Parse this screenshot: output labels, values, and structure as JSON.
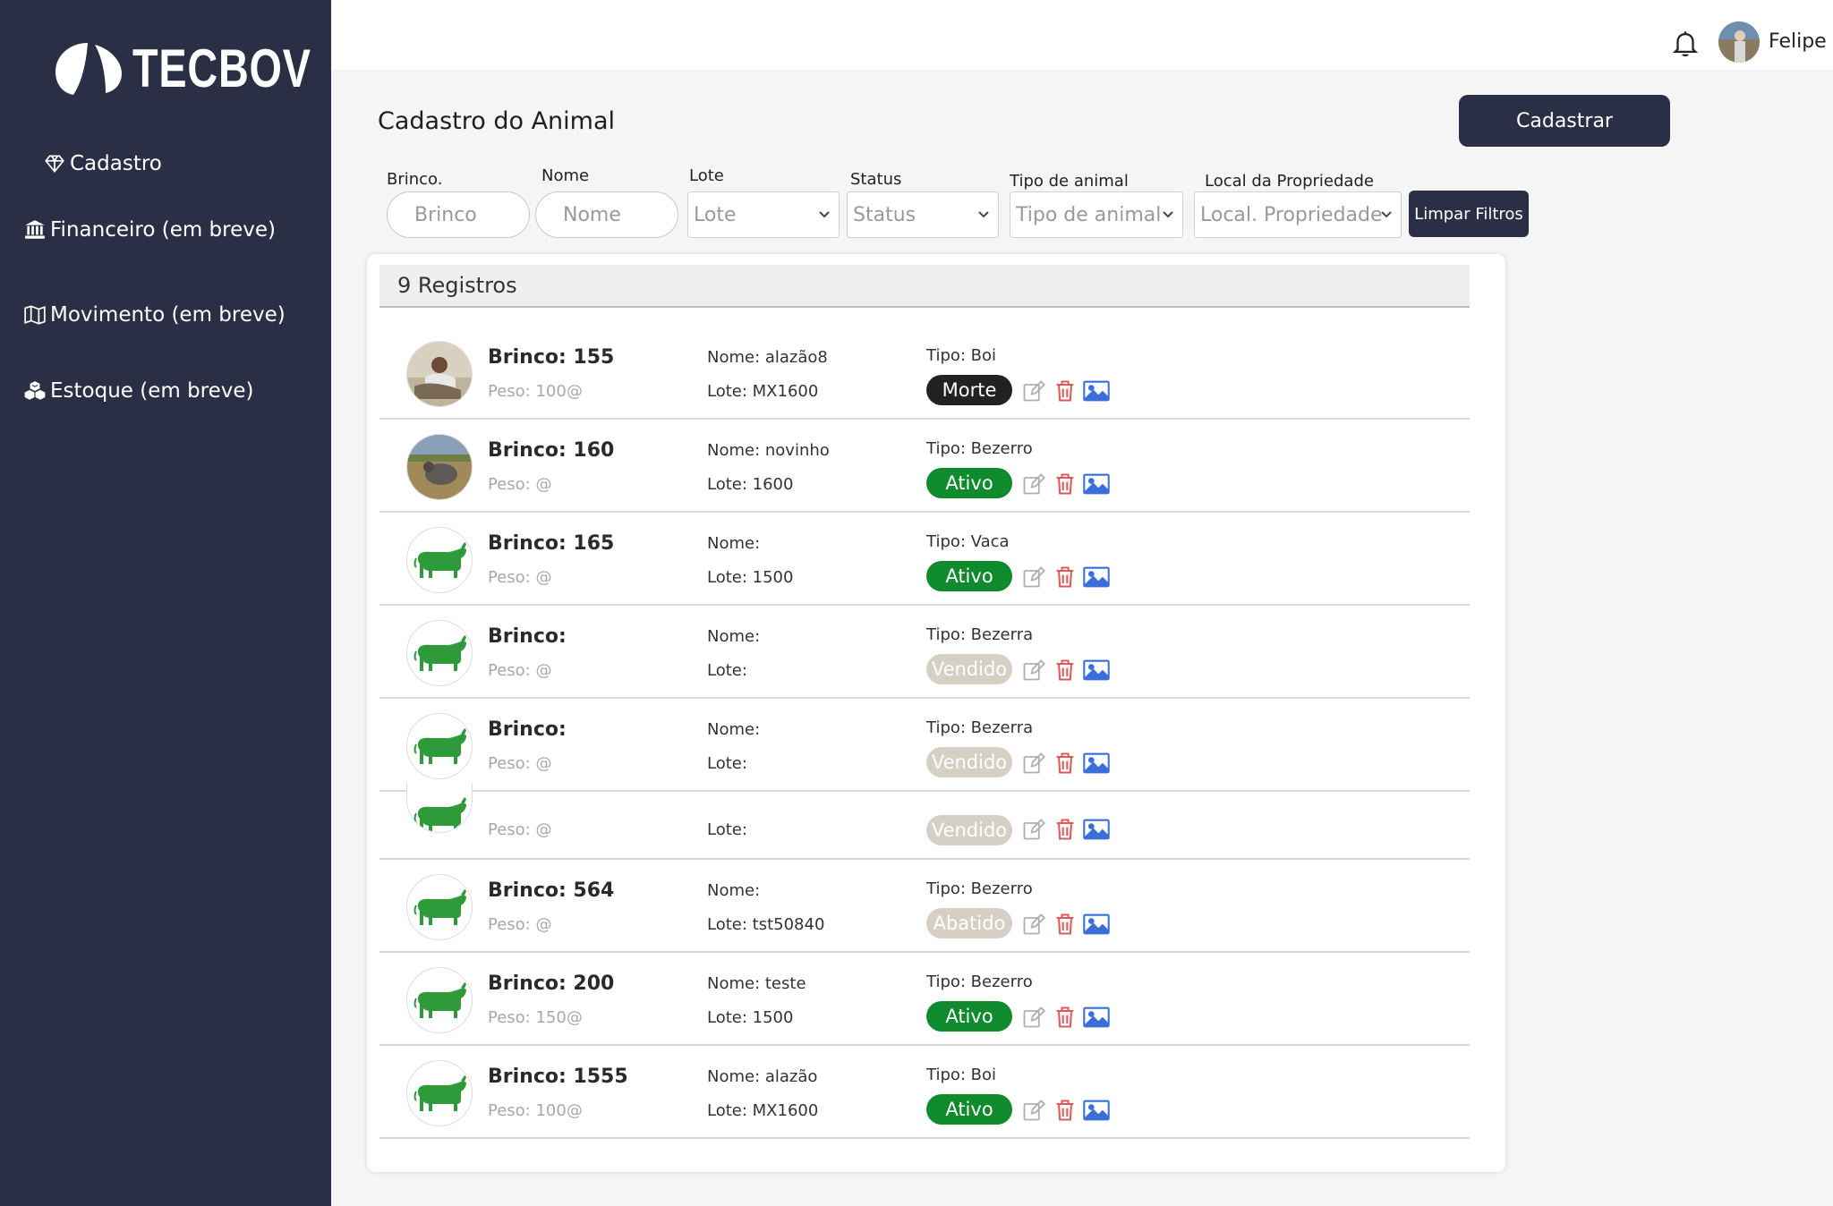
{
  "brand": {
    "name": "TECBOV"
  },
  "sidebar": {
    "items": [
      {
        "label": "Cadastro",
        "icon": "diamond-icon"
      },
      {
        "label": "Financeiro (em breve)",
        "icon": "bank-icon"
      },
      {
        "label": "Movimento (em breve)",
        "icon": "map-icon"
      },
      {
        "label": "Estoque (em breve)",
        "icon": "boxes-icon"
      }
    ]
  },
  "topbar": {
    "user_name": "Felipe"
  },
  "page": {
    "title": "Cadastro do Animal",
    "cadastrar_label": "Cadastrar"
  },
  "filters": {
    "brinco_label": "Brinco.",
    "brinco_placeholder": "Brinco",
    "nome_label": "Nome",
    "nome_placeholder": "Nome",
    "lote_label": "Lote",
    "lote_value": "Lote",
    "status_label": "Status",
    "status_value": "Status",
    "tipo_label": "Tipo de animal",
    "tipo_value": "Tipo de animal",
    "local_label": "Local da Propriedade",
    "local_value": "Local. Propriedade",
    "clear_label": "Limpar Filtros"
  },
  "list": {
    "count_label": "9 Registros",
    "rows": [
      {
        "brinco": "Brinco: 155",
        "peso": "Peso: 100@",
        "nome": "Nome: alazão8",
        "lote": "Lote: MX1600",
        "tipo": "Tipo: Boi",
        "status": "Morte",
        "status_color": "#222222",
        "thumb": "photo-man"
      },
      {
        "brinco": "Brinco: 160",
        "peso": "Peso: @",
        "nome": "Nome: novinho",
        "lote": "Lote: 1600",
        "tipo": "Tipo: Bezerro",
        "status": "Ativo",
        "status_color": "#0f8a2c",
        "thumb": "photo-cow"
      },
      {
        "brinco": "Brinco: 165",
        "peso": "Peso: @",
        "nome": "Nome:",
        "lote": "Lote: 1500",
        "tipo": "Tipo: Vaca",
        "status": "Ativo",
        "status_color": "#0f8a2c",
        "thumb": "cow-icon"
      },
      {
        "brinco": "Brinco:",
        "peso": "Peso: @",
        "nome": "Nome:",
        "lote": "Lote:",
        "tipo": "Tipo: Bezerra",
        "status": "Vendido",
        "status_color": "#d6cfc4",
        "thumb": "cow-icon"
      },
      {
        "brinco": "Brinco:",
        "peso": "Peso: @",
        "nome": "Nome:",
        "lote": "Lote:",
        "tipo": "Tipo: Bezerra",
        "status": "Vendido",
        "status_color": "#d6cfc4",
        "thumb": "cow-icon"
      },
      {
        "brinco": "",
        "peso": "Peso: @",
        "nome": "",
        "lote": "Lote:",
        "tipo": "",
        "status": "Vendido",
        "status_color": "#d6cfc4",
        "thumb": "cow-icon"
      },
      {
        "brinco": "Brinco: 564",
        "peso": "Peso: @",
        "nome": "Nome:",
        "lote": "Lote: tst50840",
        "tipo": "Tipo: Bezerro",
        "status": "Abatido",
        "status_color": "#d6cfc4",
        "thumb": "cow-icon"
      },
      {
        "brinco": "Brinco: 200",
        "peso": "Peso: 150@",
        "nome": "Nome: teste",
        "lote": "Lote: 1500",
        "tipo": "Tipo: Bezerro",
        "status": "Ativo",
        "status_color": "#0f8a2c",
        "thumb": "cow-icon"
      },
      {
        "brinco": "Brinco: 1555",
        "peso": "Peso: 100@",
        "nome": "Nome: alazão",
        "lote": "Lote: MX1600",
        "tipo": "Tipo: Boi",
        "status": "Ativo",
        "status_color": "#0f8a2c",
        "thumb": "cow-icon"
      }
    ]
  },
  "colors": {
    "sidebar_bg": "#2b2f45",
    "active_green": "#0f8a2c",
    "delete_red": "#e05a5a",
    "image_blue": "#3b6fd8"
  }
}
